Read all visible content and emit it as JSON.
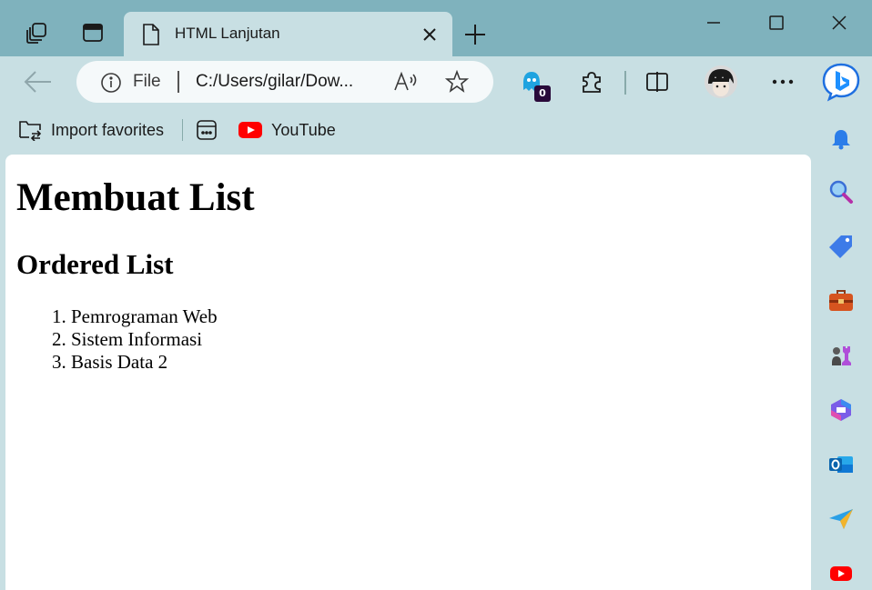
{
  "tab": {
    "title": "HTML Lanjutan"
  },
  "omnibox": {
    "scheme_label": "File",
    "url": "C:/Users/gilar/Dow..."
  },
  "extensions": {
    "ghostery_count": "0"
  },
  "favorites": {
    "import_label": "Import favorites",
    "youtube_label": "YouTube"
  },
  "page": {
    "heading": "Membuat List",
    "subheading": "Ordered List",
    "list_items": [
      "Pemrograman Web",
      "Sistem Informasi",
      "Basis Data 2"
    ]
  },
  "colors": {
    "tabstrip": "#7fb2bd",
    "toolbar": "#c8dfe3",
    "youtube": "#ff0000",
    "bing": "#1e90ff"
  }
}
